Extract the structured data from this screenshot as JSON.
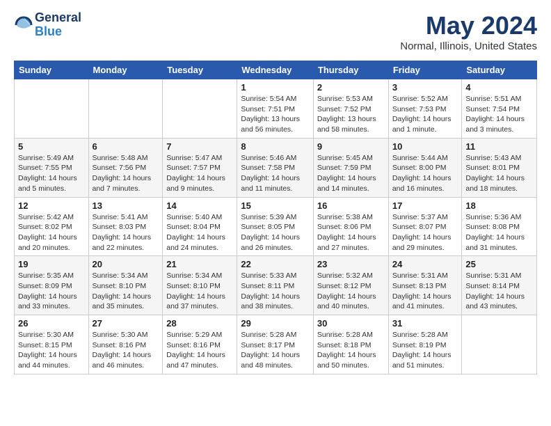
{
  "header": {
    "logo_line1": "General",
    "logo_line2": "Blue",
    "month": "May 2024",
    "location": "Normal, Illinois, United States"
  },
  "days_of_week": [
    "Sunday",
    "Monday",
    "Tuesday",
    "Wednesday",
    "Thursday",
    "Friday",
    "Saturday"
  ],
  "weeks": [
    [
      {
        "day": "",
        "info": ""
      },
      {
        "day": "",
        "info": ""
      },
      {
        "day": "",
        "info": ""
      },
      {
        "day": "1",
        "info": "Sunrise: 5:54 AM\nSunset: 7:51 PM\nDaylight: 13 hours\nand 56 minutes."
      },
      {
        "day": "2",
        "info": "Sunrise: 5:53 AM\nSunset: 7:52 PM\nDaylight: 13 hours\nand 58 minutes."
      },
      {
        "day": "3",
        "info": "Sunrise: 5:52 AM\nSunset: 7:53 PM\nDaylight: 14 hours\nand 1 minute."
      },
      {
        "day": "4",
        "info": "Sunrise: 5:51 AM\nSunset: 7:54 PM\nDaylight: 14 hours\nand 3 minutes."
      }
    ],
    [
      {
        "day": "5",
        "info": "Sunrise: 5:49 AM\nSunset: 7:55 PM\nDaylight: 14 hours\nand 5 minutes."
      },
      {
        "day": "6",
        "info": "Sunrise: 5:48 AM\nSunset: 7:56 PM\nDaylight: 14 hours\nand 7 minutes."
      },
      {
        "day": "7",
        "info": "Sunrise: 5:47 AM\nSunset: 7:57 PM\nDaylight: 14 hours\nand 9 minutes."
      },
      {
        "day": "8",
        "info": "Sunrise: 5:46 AM\nSunset: 7:58 PM\nDaylight: 14 hours\nand 11 minutes."
      },
      {
        "day": "9",
        "info": "Sunrise: 5:45 AM\nSunset: 7:59 PM\nDaylight: 14 hours\nand 14 minutes."
      },
      {
        "day": "10",
        "info": "Sunrise: 5:44 AM\nSunset: 8:00 PM\nDaylight: 14 hours\nand 16 minutes."
      },
      {
        "day": "11",
        "info": "Sunrise: 5:43 AM\nSunset: 8:01 PM\nDaylight: 14 hours\nand 18 minutes."
      }
    ],
    [
      {
        "day": "12",
        "info": "Sunrise: 5:42 AM\nSunset: 8:02 PM\nDaylight: 14 hours\nand 20 minutes."
      },
      {
        "day": "13",
        "info": "Sunrise: 5:41 AM\nSunset: 8:03 PM\nDaylight: 14 hours\nand 22 minutes."
      },
      {
        "day": "14",
        "info": "Sunrise: 5:40 AM\nSunset: 8:04 PM\nDaylight: 14 hours\nand 24 minutes."
      },
      {
        "day": "15",
        "info": "Sunrise: 5:39 AM\nSunset: 8:05 PM\nDaylight: 14 hours\nand 26 minutes."
      },
      {
        "day": "16",
        "info": "Sunrise: 5:38 AM\nSunset: 8:06 PM\nDaylight: 14 hours\nand 27 minutes."
      },
      {
        "day": "17",
        "info": "Sunrise: 5:37 AM\nSunset: 8:07 PM\nDaylight: 14 hours\nand 29 minutes."
      },
      {
        "day": "18",
        "info": "Sunrise: 5:36 AM\nSunset: 8:08 PM\nDaylight: 14 hours\nand 31 minutes."
      }
    ],
    [
      {
        "day": "19",
        "info": "Sunrise: 5:35 AM\nSunset: 8:09 PM\nDaylight: 14 hours\nand 33 minutes."
      },
      {
        "day": "20",
        "info": "Sunrise: 5:34 AM\nSunset: 8:10 PM\nDaylight: 14 hours\nand 35 minutes."
      },
      {
        "day": "21",
        "info": "Sunrise: 5:34 AM\nSunset: 8:10 PM\nDaylight: 14 hours\nand 37 minutes."
      },
      {
        "day": "22",
        "info": "Sunrise: 5:33 AM\nSunset: 8:11 PM\nDaylight: 14 hours\nand 38 minutes."
      },
      {
        "day": "23",
        "info": "Sunrise: 5:32 AM\nSunset: 8:12 PM\nDaylight: 14 hours\nand 40 minutes."
      },
      {
        "day": "24",
        "info": "Sunrise: 5:31 AM\nSunset: 8:13 PM\nDaylight: 14 hours\nand 41 minutes."
      },
      {
        "day": "25",
        "info": "Sunrise: 5:31 AM\nSunset: 8:14 PM\nDaylight: 14 hours\nand 43 minutes."
      }
    ],
    [
      {
        "day": "26",
        "info": "Sunrise: 5:30 AM\nSunset: 8:15 PM\nDaylight: 14 hours\nand 44 minutes."
      },
      {
        "day": "27",
        "info": "Sunrise: 5:30 AM\nSunset: 8:16 PM\nDaylight: 14 hours\nand 46 minutes."
      },
      {
        "day": "28",
        "info": "Sunrise: 5:29 AM\nSunset: 8:16 PM\nDaylight: 14 hours\nand 47 minutes."
      },
      {
        "day": "29",
        "info": "Sunrise: 5:28 AM\nSunset: 8:17 PM\nDaylight: 14 hours\nand 48 minutes."
      },
      {
        "day": "30",
        "info": "Sunrise: 5:28 AM\nSunset: 8:18 PM\nDaylight: 14 hours\nand 50 minutes."
      },
      {
        "day": "31",
        "info": "Sunrise: 5:28 AM\nSunset: 8:19 PM\nDaylight: 14 hours\nand 51 minutes."
      },
      {
        "day": "",
        "info": ""
      }
    ]
  ]
}
